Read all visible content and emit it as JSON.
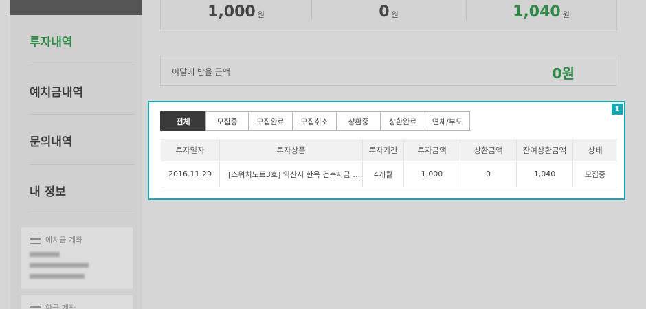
{
  "sidebar": {
    "items": [
      {
        "label": "투자내역",
        "active": true
      },
      {
        "label": "예치금내역",
        "active": false
      },
      {
        "label": "문의내역",
        "active": false
      },
      {
        "label": "내 정보",
        "active": false
      }
    ],
    "deposit_account_title": "예치금 계좌",
    "refund_account_title": "환급 계좌"
  },
  "summary": [
    {
      "value": "1,000",
      "unit": "원",
      "color": "#444444"
    },
    {
      "value": "0",
      "unit": "원",
      "color": "#444444"
    },
    {
      "value": "1,040",
      "unit": "원",
      "color": "#2e8a46"
    }
  ],
  "monthly": {
    "label": "이달에 받을 금액",
    "amount": "0원"
  },
  "panel": {
    "badge": "1",
    "tabs": [
      "전체",
      "모집중",
      "모집완료",
      "모집취소",
      "상환중",
      "상환완료",
      "연체/부도"
    ],
    "active_tab": 0,
    "columns": [
      "투자일자",
      "투자상품",
      "투자기간",
      "투자금액",
      "상환금액",
      "잔여상환금액",
      "상태"
    ],
    "rows": [
      [
        "2016.11.29",
        "[스위치노트3호] 익산시 한옥 건축자금 …",
        "4개월",
        "1,000",
        "0",
        "1,040",
        "모집중"
      ]
    ]
  },
  "colors": {
    "accent_green": "#2e8a46",
    "highlight_teal": "#17a8b6",
    "active_tab_bg": "#3a3a3a"
  }
}
